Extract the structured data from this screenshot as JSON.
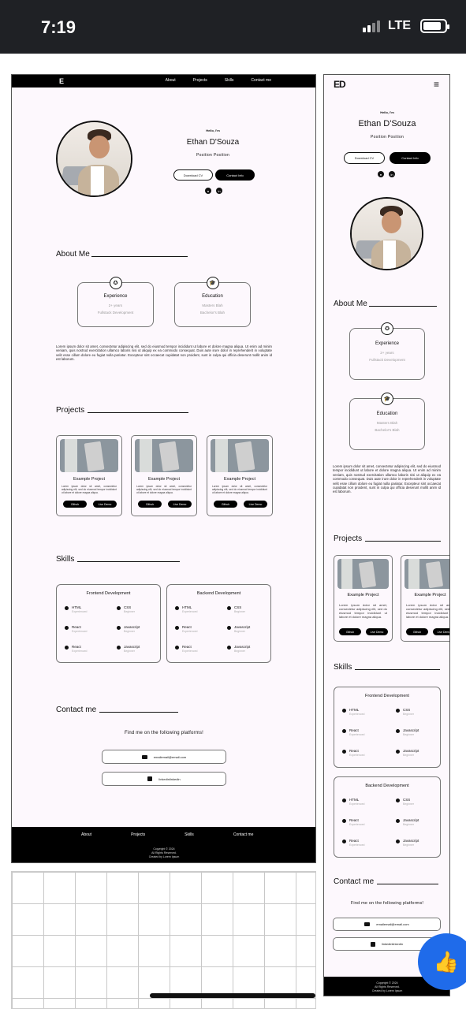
{
  "status": {
    "time": "7:19",
    "network": "LTE"
  },
  "site": {
    "logo_desktop": "E",
    "logo_mobile": "ED",
    "nav": [
      "About",
      "Projects",
      "Skills",
      "Contact me"
    ],
    "hello": "Hello, I'm",
    "name": "Ethan D'Souza",
    "position": "Position Position",
    "btn_cv": "Download CV",
    "btn_contact": "Contact Info",
    "about_title": "About Me",
    "experience": {
      "title": "Experience",
      "line1": "2+ years",
      "line2": "Fullstack Development"
    },
    "education": {
      "title": "Education",
      "line1": "Masters Blah",
      "line2": "Bachelor's Blah"
    },
    "lorem": "Lorem ipsum dolor sit amet, consectetur adipiscing elit, sed do eiusmod tempor incididunt ut labore et dolore magna aliqua. Ut enim ad minim veniam, quis nostrud exercitation ullamco laboris nisi ut aliquip ex ea commodo consequat. Duis aute irure dolor in reprehenderit in voluptate velit esse cillum dolore eu fugiat nulla pariatur. Excepteur sint occaecat cupidatat non proident, sunt in culpa qui officia deserunt mollit anim id est laborum.",
    "projects_title": "Projects",
    "project": {
      "title": "Example Project",
      "desc": "Lorem ipsum dolor sit amet, consectetur adipiscing elit, sed do eiusmod tempor incididunt ut labore et dolore magna aliqua.",
      "github": "Github",
      "demo": "Live Demo"
    },
    "skills_title": "Skills",
    "frontend": {
      "title": "Frontend Development",
      "items": [
        {
          "name": "HTML",
          "level": "Experienced"
        },
        {
          "name": "CSS",
          "level": "Beginner"
        },
        {
          "name": "React",
          "level": "Experienced"
        },
        {
          "name": "Javascript",
          "level": "Beginner"
        },
        {
          "name": "React",
          "level": "Experienced"
        },
        {
          "name": "Javascript",
          "level": "Beginner"
        }
      ]
    },
    "backend": {
      "title": "Backend Development",
      "items": [
        {
          "name": "HTML",
          "level": "Experienced"
        },
        {
          "name": "CSS",
          "level": "Beginner"
        },
        {
          "name": "React",
          "level": "Experienced"
        },
        {
          "name": "Javascript",
          "level": "Beginner"
        },
        {
          "name": "React",
          "level": "Experienced"
        },
        {
          "name": "Javascript",
          "level": "Beginner"
        }
      ]
    },
    "contact_title": "Contact me",
    "contact_find": "Find me on the following platforms!",
    "email": "emailemail@email.com",
    "linkedin": "linkedinlinkedin",
    "footer": {
      "copyright": "Copyright © 2024",
      "rights": "All Rights Reserved.",
      "credit": "Created by Lorem Ipsum"
    }
  }
}
